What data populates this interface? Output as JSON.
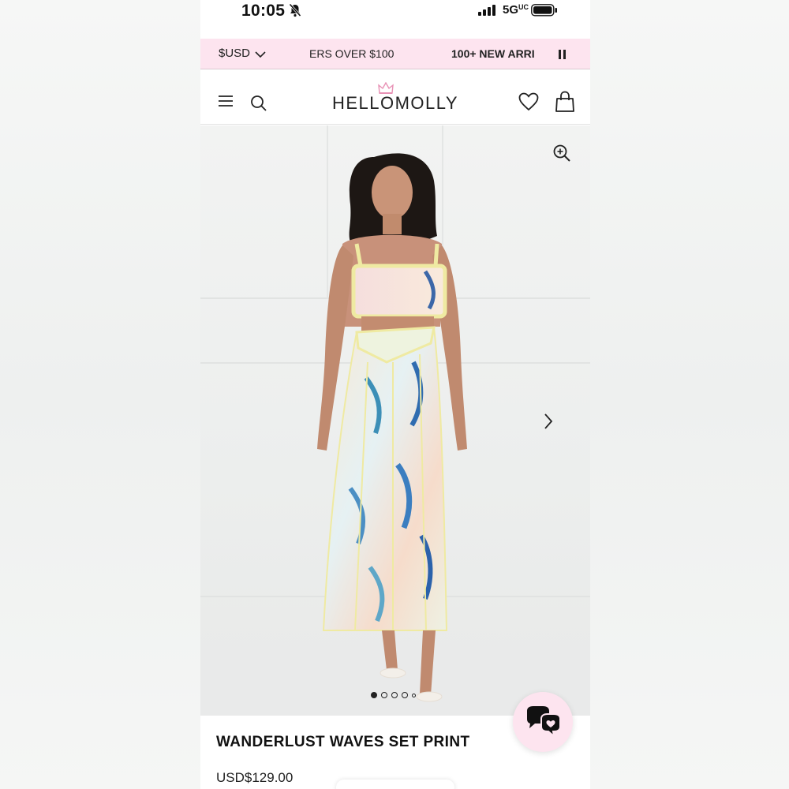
{
  "status_bar": {
    "time": "10:05",
    "network": "5G",
    "network_suffix": "UC"
  },
  "promo_bar": {
    "currency": "$USD",
    "message_1": "ERS OVER $100",
    "message_2": "100+ NEW ARRI"
  },
  "header": {
    "logo": "HELLOMOLLY"
  },
  "gallery": {
    "image_count": 5,
    "active_index": 0
  },
  "product": {
    "title": "WANDERLUST WAVES SET PRINT",
    "price": "USD$129.00"
  },
  "colors": {
    "promo_bg": "#fde4ef",
    "crown": "#e891b5",
    "text": "#111111"
  }
}
